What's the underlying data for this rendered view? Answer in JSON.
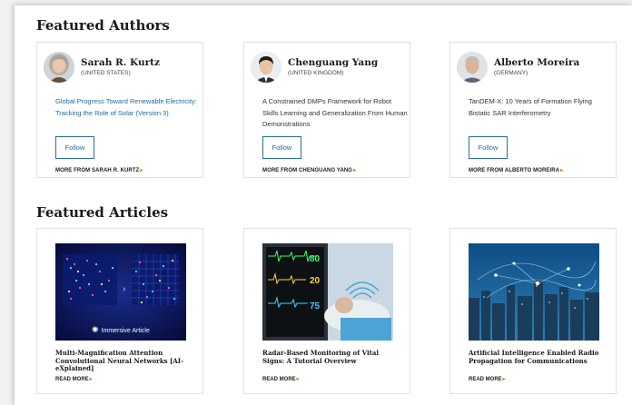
{
  "sections": {
    "authors_title": "Featured Authors",
    "articles_title": "Featured Articles"
  },
  "authors": [
    {
      "name": "Sarah R. Kurtz",
      "country": "(UNITED STATES)",
      "paper": "Global Progress Toward Renewable Electricity: Tracking the Role of Solar (Version 3)",
      "follow": "Follow",
      "more": "MORE FROM SARAH R. KURTZ"
    },
    {
      "name": "Chenguang Yang",
      "country": "(UNITED KINGDOM)",
      "paper": "A Constrained DMPs Framework for Robot Skills Learning and Generalization From Human Demonstrations",
      "follow": "Follow",
      "more": "MORE FROM CHENGUANG YANG"
    },
    {
      "name": "Alberto Moreira",
      "country": "(GERMANY)",
      "paper": "TanDEM-X: 10 Years of Formation Flying Bistatic SAR Interferometry",
      "follow": "Follow",
      "more": "MORE FROM ALBERTO MOREIRA"
    }
  ],
  "articles": [
    {
      "badge": "Immersive Article",
      "title": "Multi-Magnification Attention Convolutional Neural Networks [AI-eXplained]",
      "read_more": "READ MORE"
    },
    {
      "monitor_readouts": [
        "80",
        "20",
        "75"
      ],
      "title": "Radar-Based Monitoring of Vital Signs: A Tutorial Overview",
      "read_more": "READ MORE"
    },
    {
      "title": "Artificial Intelligence Enabled Radio Propagation for Communications",
      "read_more": "READ MORE"
    }
  ],
  "icons": {
    "chevron": "chevron-right-icon",
    "badge": "sparkle-icon"
  },
  "colors": {
    "link": "#1e6aa0",
    "accent": "#e07b1a",
    "border": "#e1e1e1"
  }
}
